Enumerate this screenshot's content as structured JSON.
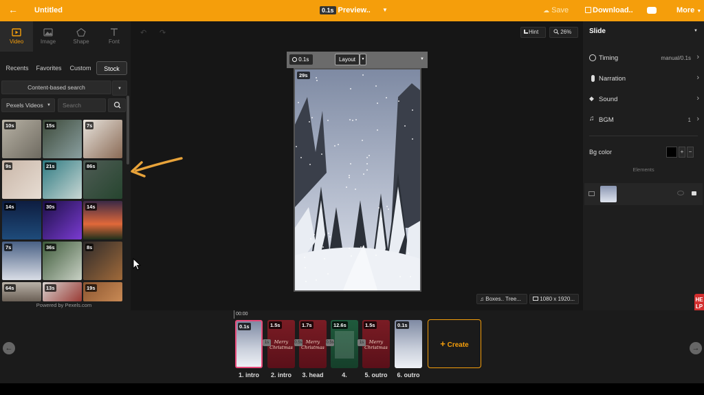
{
  "colors": {
    "accent": "#f59e0b",
    "help": "#d32f2f"
  },
  "topbar": {
    "title": "Untitled",
    "preview_badge": "0.1s",
    "preview_label": "Preview..",
    "save": "Save",
    "download": "Download..",
    "more": "More"
  },
  "left": {
    "tabs": [
      {
        "label": "Video",
        "icon": "video-icon"
      },
      {
        "label": "Image",
        "icon": "image-icon"
      },
      {
        "label": "Shape",
        "icon": "shape-icon"
      },
      {
        "label": "Font",
        "icon": "text-icon"
      }
    ],
    "subtabs": [
      "Recents",
      "Favorites",
      "Custom",
      "Stock"
    ],
    "search_mode": "Content-based search",
    "source": "Pexels Videos",
    "search_placeholder": "Search",
    "thumbs": [
      "10s",
      "15s",
      "7s",
      "9s",
      "21s",
      "86s",
      "14s",
      "30s",
      "14s",
      "7s",
      "36s",
      "8s",
      "64s",
      "13s",
      "19s"
    ],
    "footer": "Powered by Pexels.com"
  },
  "canvas": {
    "hint": "Hint",
    "zoom": "26%",
    "time": "0.1s",
    "layout": "Layout",
    "frame_duration": "29s",
    "bgm": "Boxes.. Tree...",
    "resolution": "1080 x 1920..."
  },
  "right": {
    "title": "Slide",
    "rows": [
      {
        "label": "Timing",
        "value": "manual/0.1s",
        "icon": "clock-icon"
      },
      {
        "label": "Narration",
        "value": "",
        "icon": "mic-icon"
      },
      {
        "label": "Sound",
        "value": "",
        "icon": "sound-icon"
      },
      {
        "label": "BGM",
        "value": "1",
        "icon": "music-icon"
      }
    ],
    "bg_color_label": "Bg color",
    "bg_color": "#000000",
    "elements_label": "Elements"
  },
  "timeline": {
    "time": "00:00",
    "clips": [
      {
        "dur": "0.1s",
        "label": "1. intro",
        "kind": "snow"
      },
      {
        "dur": "1.5s",
        "label": "2. intro",
        "kind": "red"
      },
      {
        "dur": "1.7s",
        "label": "3. head",
        "kind": "red"
      },
      {
        "dur": "12.6s",
        "label": "4.",
        "kind": "green"
      },
      {
        "dur": "1.5s",
        "label": "5. outro",
        "kind": "red"
      },
      {
        "dur": "0.1s",
        "label": "6. outro",
        "kind": "snow"
      }
    ],
    "transitions": [
      "1s",
      "0.5s",
      "0.5s",
      "1s"
    ],
    "merry_christmas": "Merry Christmas",
    "create": "Create"
  },
  "help": "HELP"
}
